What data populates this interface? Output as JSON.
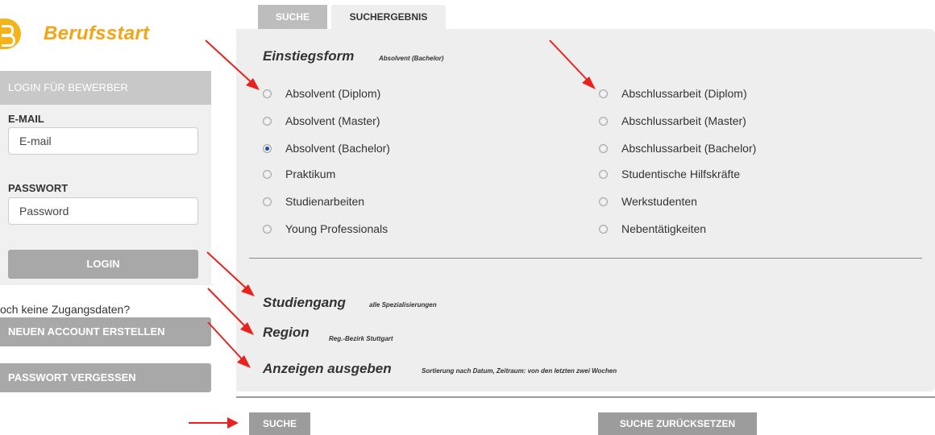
{
  "brand": {
    "name": "Berufsstart",
    "logo_letter": "B",
    "accent": "#f5a414"
  },
  "login": {
    "header": "LOGIN FÜR BEWERBER",
    "email_label": "E-MAIL",
    "email_placeholder": "E-mail",
    "password_label": "PASSWORT",
    "password_placeholder": "Password",
    "login_button": "LOGIN"
  },
  "sidebar": {
    "no_access_text": "och keine Zugangsdaten?",
    "new_account_button": "NEUEN ACCOUNT ERSTELLEN",
    "forgot_password_button": "PASSWORT VERGESSEN"
  },
  "tabs": [
    {
      "label": "SUCHE",
      "active": false
    },
    {
      "label": "SUCHERGEBNIS",
      "active": true
    }
  ],
  "einstiegsform": {
    "title": "Einstiegsform",
    "selected_summary": "Absolvent (Bachelor)",
    "options_left": [
      {
        "label": "Absolvent (Diplom)",
        "checked": false
      },
      {
        "label": "Absolvent (Master)",
        "checked": false
      },
      {
        "label": "Absolvent (Bachelor)",
        "checked": true
      },
      {
        "label": "Praktikum",
        "checked": false
      },
      {
        "label": "Studienarbeiten",
        "checked": false
      },
      {
        "label": "Young Professionals",
        "checked": false
      }
    ],
    "options_right": [
      {
        "label": "Abschlussarbeit (Diplom)",
        "checked": false
      },
      {
        "label": "Abschlussarbeit (Master)",
        "checked": false
      },
      {
        "label": "Abschlussarbeit (Bachelor)",
        "checked": false
      },
      {
        "label": "Studentische Hilfskräfte",
        "checked": false
      },
      {
        "label": "Werkstudenten",
        "checked": false
      },
      {
        "label": "Nebentätigkeiten",
        "checked": false
      }
    ]
  },
  "sections": {
    "studiengang": {
      "title": "Studiengang",
      "summary": "alle Spezialisierungen"
    },
    "region": {
      "title": "Region",
      "summary": "Reg.-Bezirk Stuttgart"
    },
    "anzeigen": {
      "title": "Anzeigen ausgeben",
      "summary": "Sortierung nach Datum, Zeitraum: von den letzten zwei Wochen"
    }
  },
  "actions": {
    "search_button": "SUCHE",
    "reset_button": "SUCHE ZURÜCKSETZEN"
  },
  "annotation_color": "#e8231f"
}
